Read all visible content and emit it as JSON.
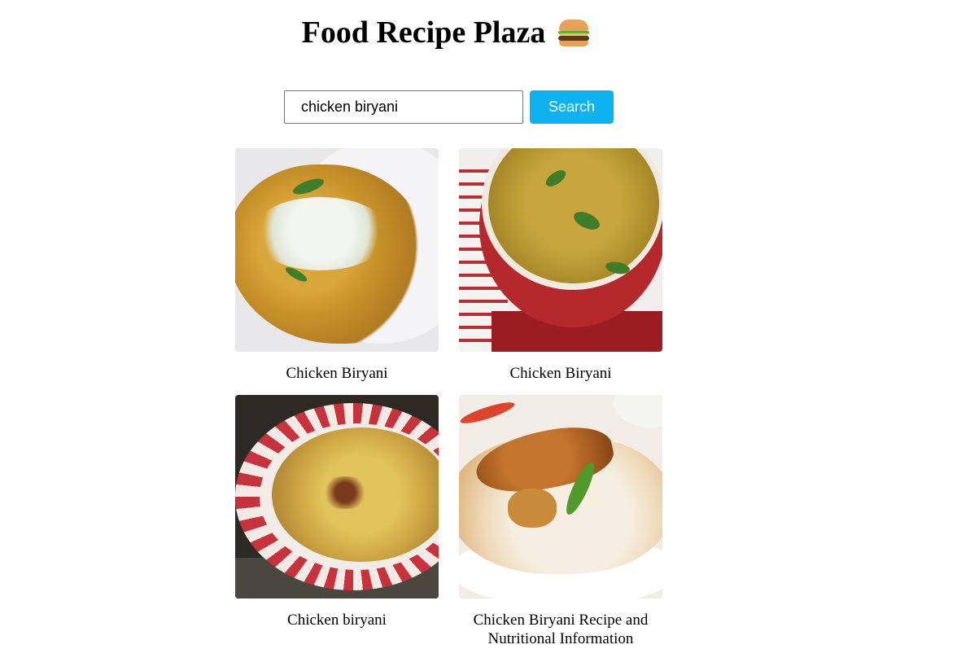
{
  "header": {
    "title": "Food Recipe Plaza",
    "emoji_icon": "burger-icon"
  },
  "search": {
    "value": "chicken biryani",
    "placeholder": "",
    "button_label": "Search",
    "button_color": "#0db3f1"
  },
  "results": [
    {
      "label": "Chicken Biryani",
      "image_icon": "chicken-biryani-photo"
    },
    {
      "label": "Chicken Biryani",
      "image_icon": "chicken-biryani-photo"
    },
    {
      "label": "Chicken biryani",
      "image_icon": "chicken-biryani-photo"
    },
    {
      "label": "Chicken Biryani Recipe and Nutritional Information",
      "image_icon": "chicken-biryani-photo"
    }
  ]
}
